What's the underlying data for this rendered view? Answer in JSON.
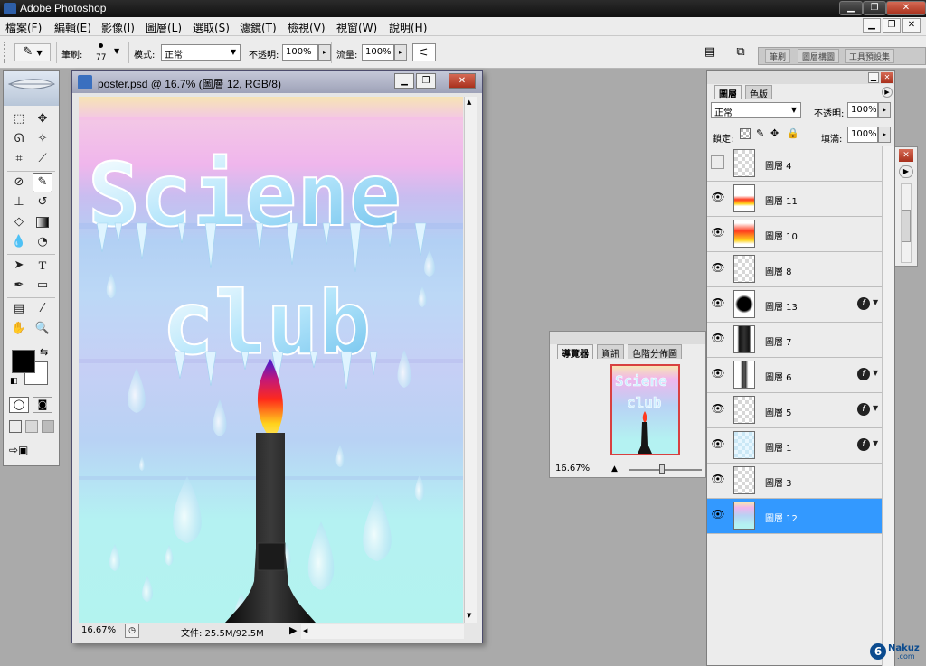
{
  "app": {
    "title": "Adobe Photoshop"
  },
  "window_controls": {
    "minimize": "▁",
    "restore": "❐",
    "close": "✕"
  },
  "menu": [
    "檔案(F)",
    "編輯(E)",
    "影像(I)",
    "圖層(L)",
    "選取(S)",
    "濾鏡(T)",
    "檢視(V)",
    "視窗(W)",
    "說明(H)"
  ],
  "options": {
    "brush_label": "筆刷:",
    "brush_size": "77",
    "mode_label": "模式:",
    "mode_value": "正常",
    "opacity_label": "不透明:",
    "opacity_value": "100%",
    "flow_label": "流量:",
    "flow_value": "100%",
    "wells": [
      "筆刷",
      "圖層構圖",
      "工具預設集"
    ]
  },
  "document": {
    "title": "poster.psd @ 16.7% (圖層 12, RGB/8)",
    "zoom": "16.67%",
    "status": "文件: 25.5M/92.5M",
    "poster_title_line1": "Sciene",
    "poster_title_line2": "club"
  },
  "navigator": {
    "tabs": [
      "導覽器",
      "資訊",
      "色階分佈圖"
    ],
    "zoom": "16.67%",
    "zoom_level": 0.45
  },
  "layers_panel": {
    "tabs": [
      "圖層",
      "色版"
    ],
    "blend_mode": "正常",
    "opacity_label": "不透明:",
    "opacity_value": "100%",
    "lock_label": "鎖定:",
    "fill_label": "填滿:",
    "fill_value": "100%",
    "layers": [
      {
        "name": "圖層 4",
        "visible": false,
        "fx": false,
        "selected": false
      },
      {
        "name": "圖層 11",
        "visible": true,
        "fx": false,
        "selected": false
      },
      {
        "name": "圖層 10",
        "visible": true,
        "fx": false,
        "selected": false
      },
      {
        "name": "圖層 8",
        "visible": true,
        "fx": false,
        "selected": false
      },
      {
        "name": "圖層 13",
        "visible": true,
        "fx": true,
        "selected": false
      },
      {
        "name": "圖層 7",
        "visible": true,
        "fx": false,
        "selected": false
      },
      {
        "name": "圖層 6",
        "visible": true,
        "fx": true,
        "selected": false
      },
      {
        "name": "圖層 5",
        "visible": true,
        "fx": true,
        "selected": false
      },
      {
        "name": "圖層 1",
        "visible": true,
        "fx": true,
        "selected": false
      },
      {
        "name": "圖層 3",
        "visible": true,
        "fx": false,
        "selected": false
      },
      {
        "name": "圖層 12",
        "visible": true,
        "fx": false,
        "selected": true
      }
    ]
  },
  "watermark": {
    "text": "Nakuz",
    "sub": ".com"
  },
  "colors": {
    "selection": "#3399ff",
    "foreground": "#000000",
    "background": "#ffffff"
  }
}
